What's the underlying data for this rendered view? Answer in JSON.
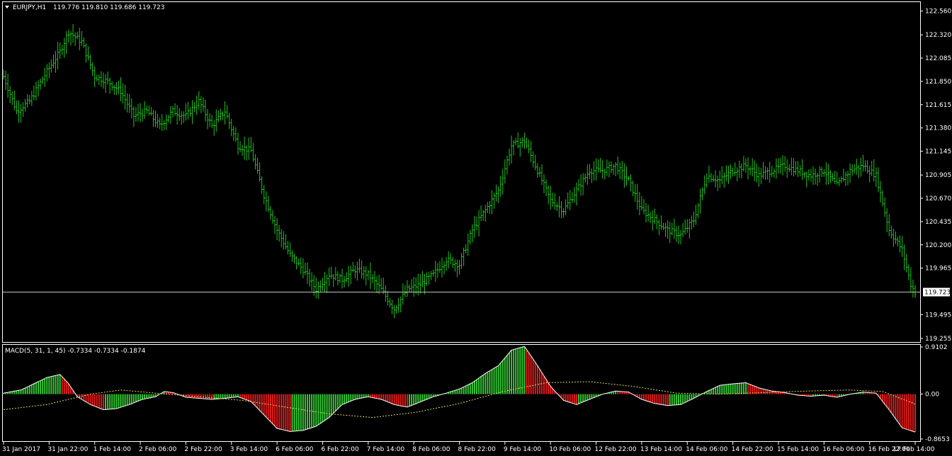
{
  "colors": {
    "background": "#000000",
    "grid_border": "#ffffff",
    "bar": "#22c322",
    "macd_up": "#34c634",
    "macd_down": "#e21b1b",
    "signal": "#e8d86a",
    "bid_line": "#c0c0c0"
  },
  "main_chart": {
    "header": {
      "symbol": "EURJPY,H1",
      "ohlc": "119.776 119.810 119.686 119.723"
    },
    "icon": "triangle-down-icon",
    "price_axis_labels": [
      "122.560",
      "122.320",
      "122.085",
      "121.850",
      "121.615",
      "121.380",
      "121.145",
      "120.905",
      "120.670",
      "120.435",
      "120.200",
      "119.965",
      "119.495",
      "119.255"
    ],
    "current_price": "119.723"
  },
  "macd_panel": {
    "header": "MACD(5, 31, 1, 45) -0.7334 -0.7334 -0.1874",
    "axis_labels": [
      "0.9102",
      "0.00",
      "-0.8653"
    ]
  },
  "time_axis_labels": [
    "31 Jan 2017",
    "31 Jan 22:00",
    "1 Feb 14:00",
    "2 Feb 06:00",
    "2 Feb 22:00",
    "3 Feb 14:00",
    "6 Feb 06:00",
    "6 Feb 22:00",
    "7 Feb 14:00",
    "8 Feb 06:00",
    "8 Feb 22:00",
    "9 Feb 14:00",
    "10 Feb 06:00",
    "12 Feb 22:00",
    "13 Feb 14:00",
    "14 Feb 06:00",
    "14 Feb 22:00",
    "15 Feb 14:00",
    "16 Feb 06:00",
    "16 Feb 22:00",
    "17 Feb 14:00"
  ],
  "chart_data": [
    {
      "type": "line",
      "title": "EURJPY,H1",
      "ylim": [
        119.255,
        122.6
      ],
      "grid": false,
      "close_anchors": [
        [
          0,
          121.9
        ],
        [
          6,
          121.55
        ],
        [
          12,
          121.65
        ],
        [
          20,
          121.95
        ],
        [
          26,
          122.15
        ],
        [
          30,
          122.35
        ],
        [
          36,
          122.25
        ],
        [
          42,
          121.9
        ],
        [
          48,
          121.85
        ],
        [
          54,
          121.75
        ],
        [
          60,
          121.5
        ],
        [
          66,
          121.55
        ],
        [
          72,
          121.4
        ],
        [
          78,
          121.55
        ],
        [
          84,
          121.5
        ],
        [
          90,
          121.65
        ],
        [
          96,
          121.4
        ],
        [
          102,
          121.55
        ],
        [
          108,
          121.2
        ],
        [
          114,
          121.15
        ],
        [
          120,
          120.7
        ],
        [
          126,
          120.35
        ],
        [
          132,
          120.1
        ],
        [
          138,
          119.95
        ],
        [
          144,
          119.75
        ],
        [
          150,
          119.9
        ],
        [
          156,
          119.85
        ],
        [
          162,
          119.95
        ],
        [
          168,
          119.9
        ],
        [
          174,
          119.75
        ],
        [
          180,
          119.55
        ],
        [
          186,
          119.75
        ],
        [
          192,
          119.8
        ],
        [
          198,
          119.9
        ],
        [
          204,
          120.05
        ],
        [
          210,
          120.0
        ],
        [
          216,
          120.35
        ],
        [
          222,
          120.55
        ],
        [
          228,
          120.75
        ],
        [
          234,
          121.2
        ],
        [
          240,
          121.25
        ],
        [
          246,
          120.95
        ],
        [
          252,
          120.65
        ],
        [
          258,
          120.55
        ],
        [
          264,
          120.75
        ],
        [
          270,
          120.95
        ],
        [
          276,
          120.95
        ],
        [
          282,
          121.0
        ],
        [
          288,
          120.85
        ],
        [
          294,
          120.55
        ],
        [
          300,
          120.45
        ],
        [
          306,
          120.35
        ],
        [
          312,
          120.3
        ],
        [
          318,
          120.45
        ],
        [
          324,
          120.9
        ],
        [
          330,
          120.85
        ],
        [
          336,
          120.95
        ],
        [
          342,
          121.0
        ],
        [
          348,
          120.9
        ],
        [
          354,
          120.95
        ],
        [
          360,
          121.0
        ],
        [
          366,
          120.95
        ],
        [
          372,
          120.9
        ],
        [
          378,
          120.95
        ],
        [
          384,
          120.8
        ],
        [
          390,
          120.95
        ],
        [
          396,
          121.0
        ],
        [
          402,
          120.9
        ],
        [
          408,
          120.35
        ],
        [
          414,
          120.15
        ],
        [
          418,
          119.8
        ],
        [
          420,
          119.72
        ]
      ]
    },
    {
      "type": "bar",
      "title": "MACD(5, 31, 1, 45)",
      "ylim": [
        -0.8653,
        0.9102
      ],
      "macd_anchors": [
        [
          0,
          0.02
        ],
        [
          8,
          0.08
        ],
        [
          14,
          0.2
        ],
        [
          20,
          0.32
        ],
        [
          26,
          0.38
        ],
        [
          30,
          0.2
        ],
        [
          34,
          -0.05
        ],
        [
          40,
          -0.2
        ],
        [
          46,
          -0.3
        ],
        [
          52,
          -0.28
        ],
        [
          58,
          -0.2
        ],
        [
          64,
          -0.1
        ],
        [
          70,
          -0.05
        ],
        [
          74,
          0.05
        ],
        [
          78,
          0.03
        ],
        [
          84,
          -0.06
        ],
        [
          90,
          -0.08
        ],
        [
          96,
          -0.1
        ],
        [
          102,
          -0.08
        ],
        [
          108,
          -0.05
        ],
        [
          114,
          -0.14
        ],
        [
          120,
          -0.4
        ],
        [
          126,
          -0.66
        ],
        [
          132,
          -0.72
        ],
        [
          138,
          -0.7
        ],
        [
          144,
          -0.62
        ],
        [
          150,
          -0.45
        ],
        [
          156,
          -0.2
        ],
        [
          162,
          -0.1
        ],
        [
          168,
          -0.05
        ],
        [
          174,
          -0.1
        ],
        [
          180,
          -0.2
        ],
        [
          186,
          -0.25
        ],
        [
          192,
          -0.15
        ],
        [
          198,
          -0.05
        ],
        [
          204,
          0.02
        ],
        [
          210,
          0.1
        ],
        [
          216,
          0.22
        ],
        [
          222,
          0.4
        ],
        [
          228,
          0.55
        ],
        [
          234,
          0.85
        ],
        [
          240,
          0.92
        ],
        [
          246,
          0.55
        ],
        [
          252,
          0.15
        ],
        [
          258,
          -0.12
        ],
        [
          264,
          -0.2
        ],
        [
          270,
          -0.1
        ],
        [
          276,
          0.0
        ],
        [
          282,
          0.06
        ],
        [
          288,
          0.04
        ],
        [
          294,
          -0.1
        ],
        [
          300,
          -0.18
        ],
        [
          306,
          -0.22
        ],
        [
          312,
          -0.2
        ],
        [
          318,
          -0.08
        ],
        [
          324,
          0.05
        ],
        [
          330,
          0.17
        ],
        [
          336,
          0.2
        ],
        [
          342,
          0.22
        ],
        [
          348,
          0.12
        ],
        [
          354,
          0.06
        ],
        [
          360,
          0.03
        ],
        [
          366,
          -0.02
        ],
        [
          372,
          -0.04
        ],
        [
          378,
          -0.02
        ],
        [
          384,
          -0.06
        ],
        [
          390,
          0.0
        ],
        [
          396,
          0.04
        ],
        [
          402,
          0.02
        ],
        [
          408,
          -0.3
        ],
        [
          414,
          -0.65
        ],
        [
          420,
          -0.73
        ]
      ],
      "signal_anchors": [
        [
          0,
          -0.3
        ],
        [
          20,
          -0.2
        ],
        [
          40,
          0.0
        ],
        [
          54,
          0.08
        ],
        [
          70,
          0.02
        ],
        [
          90,
          -0.05
        ],
        [
          110,
          -0.12
        ],
        [
          130,
          -0.25
        ],
        [
          150,
          -0.38
        ],
        [
          170,
          -0.45
        ],
        [
          190,
          -0.35
        ],
        [
          210,
          -0.18
        ],
        [
          230,
          0.05
        ],
        [
          250,
          0.22
        ],
        [
          270,
          0.24
        ],
        [
          290,
          0.15
        ],
        [
          310,
          0.02
        ],
        [
          330,
          0.0
        ],
        [
          350,
          0.03
        ],
        [
          370,
          0.06
        ],
        [
          390,
          0.08
        ],
        [
          405,
          0.05
        ],
        [
          420,
          -0.19
        ]
      ]
    }
  ]
}
